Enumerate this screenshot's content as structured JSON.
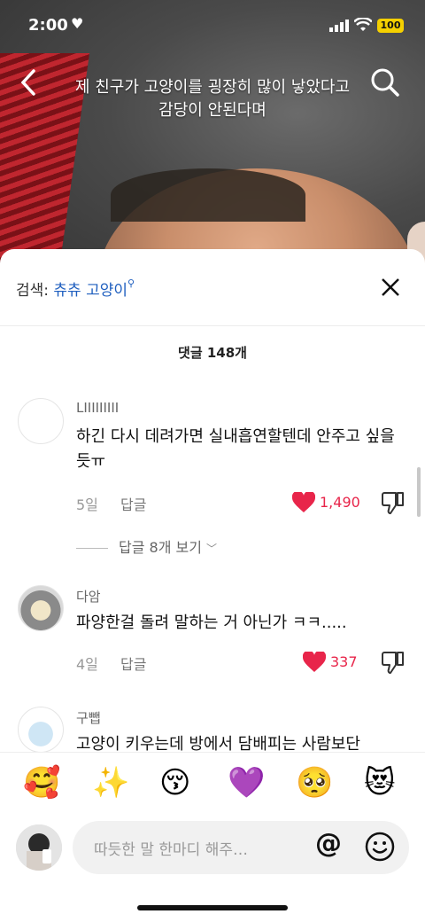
{
  "status": {
    "time": "2:00",
    "battery": "100"
  },
  "video": {
    "caption_line1": "제 친구가 고양이를 굉장히 많이 낳았다고",
    "caption_line2": "감당이 안된다며"
  },
  "sheet": {
    "search_prefix": "검색:",
    "search_term": "츄츄 고양이",
    "comment_count": "댓글 148개",
    "reply_label": "답글"
  },
  "comments": [
    {
      "user": "LIIIIIIIII",
      "text": "하긴 다시 데려가면 실내흡연할텐데 안주고 싶을듯ㅠ",
      "age": "5일",
      "likes": "1,490",
      "view_replies": "답글 8개 보기"
    },
    {
      "user": "다암",
      "text": "파양한걸 돌려 말하는 거 아닌가 ㅋㅋ.....",
      "age": "4일",
      "likes": "337"
    },
    {
      "user": "구뺍",
      "text": "고양이 키우는데 방에서 담배피는 사람보단"
    }
  ],
  "emoji_bar": [
    "🥰",
    "✨",
    "😚",
    "💜",
    "🥺",
    "😻"
  ],
  "input": {
    "placeholder": "따듯한 말 한마디 해주…",
    "at": "@"
  },
  "colors": {
    "accent_blue": "#1f5fbf",
    "like_red": "#e8254a"
  }
}
